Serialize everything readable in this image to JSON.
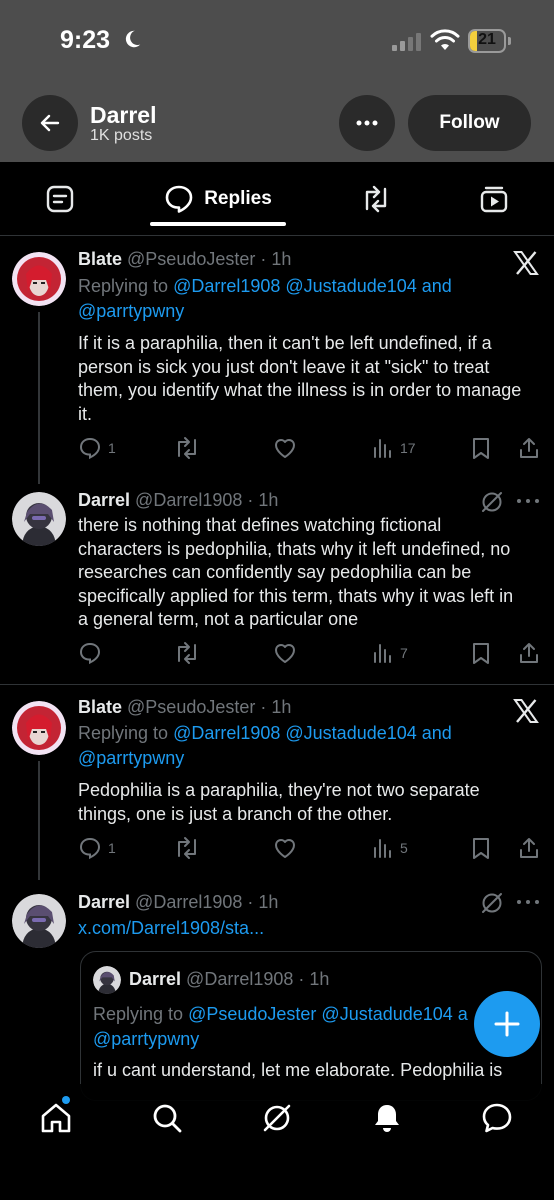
{
  "status_bar": {
    "time": "9:23",
    "battery": "21",
    "battery_percent": 21
  },
  "profile_header": {
    "name": "Darrel",
    "post_count": "1K posts",
    "follow_label": "Follow"
  },
  "tabs": [
    {
      "label": "Replies",
      "active": true
    }
  ],
  "posts": [
    {
      "name": "Blate",
      "handle": "@PseudoJester · 1h",
      "replying_prefix": "Replying to",
      "replying_mentions_line1": "@Darrel1908 @Justadude104 and",
      "replying_mentions_line2": "@parrtypwny",
      "text": "If it is a paraphilia, then it can't be left undefined, if a person is sick you just don't leave it at \"sick\" to treat them, you identify what the illness is in order to manage it.",
      "replies": "1",
      "views": "17",
      "corner_icon": "x-logo-icon"
    },
    {
      "name": "Darrel",
      "handle": "@Darrel1908 · 1h",
      "text": "there is nothing that defines watching fictional characters is pedophilia, thats why it left undefined, no researches can confidently say pedophilia can be specifically applied for this term, thats why it was left in a general term, not a particular one",
      "views": "7",
      "corner_icon": "grok-icon"
    },
    {
      "name": "Blate",
      "handle": "@PseudoJester · 1h",
      "replying_prefix": "Replying to",
      "replying_mentions_line1": "@Darrel1908 @Justadude104 and",
      "replying_mentions_line2": "@parrtypwny",
      "text": "Pedophilia is a paraphilia, they're not two separate things, one is just a branch of the other.",
      "replies": "1",
      "views": "5",
      "corner_icon": "x-logo-icon"
    },
    {
      "name": "Darrel",
      "handle": "@Darrel1908 · 1h",
      "link": "x.com/Darrel1908/sta...",
      "corner_icon": "grok-icon",
      "quote": {
        "name": "Darrel",
        "handle": "@Darrel1908 · 1h",
        "replying_prefix": "Replying to",
        "replying_mentions_line1": "@PseudoJester @Justadude104 a",
        "replying_mentions_line2": "@parrtypwny",
        "text": "if u cant understand, let me elaborate. Pedophilia is"
      }
    }
  ],
  "bottom_nav": [
    "home-icon",
    "search-icon",
    "grok-icon",
    "notifications-icon",
    "messages-icon"
  ],
  "colors": {
    "accent": "#1d9bf0",
    "header_bg": "#4d4d4d",
    "muted": "#71767b",
    "battery": "#f3cf3d"
  }
}
